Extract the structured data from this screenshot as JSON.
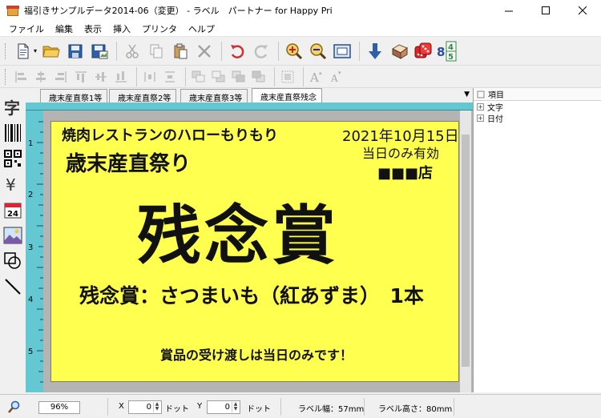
{
  "window": {
    "title": "福引きサンプルデータ2014-06（変更） - ラベル　パートナー for Happy Pri"
  },
  "menu": [
    "ファイル",
    "編集",
    "表示",
    "挿入",
    "プリンタ",
    "ヘルプ"
  ],
  "tabs": [
    "歳末産直祭1等",
    "歳末産直祭2等",
    "歳末産直祭3等",
    "歳末産直祭残念"
  ],
  "active_tab_index": 3,
  "ruler": [
    "1",
    "2",
    "3",
    "4",
    "5"
  ],
  "label": {
    "background": "#ffff50",
    "store_line": "焼肉レストランのハローもりもり",
    "date": "2021年10月15日",
    "validity": "当日のみ有効",
    "event_name": "歳末産直祭り",
    "shop": "■■■店",
    "prize_big": "残念賞",
    "prize_detail": "残念賞：さつまいも（紅あずま）　1本",
    "footer": "賞品の受け渡しは当日のみです！"
  },
  "tree": {
    "header": "項目",
    "items": [
      "文字",
      "日付"
    ]
  },
  "status": {
    "zoom": "96%",
    "x_label": "X",
    "x_value": "0",
    "x_unit": "ドット",
    "y_label": "Y",
    "y_value": "0",
    "y_unit": "ドット",
    "label_width": "ラベル幅：57mm",
    "label_height": "ラベル高さ：80mm"
  },
  "icons": {
    "toolbar1": [
      "new-document-icon",
      "open-folder-icon",
      "save-icon",
      "save-as-icon",
      "cut-icon",
      "copy-icon",
      "paste-icon",
      "delete-icon",
      "undo-icon",
      "redo-icon",
      "zoom-in-icon",
      "zoom-out-icon",
      "fit-page-icon",
      "import-icon",
      "print-icon",
      "lottery-dice-icon",
      "serial-number-icon"
    ],
    "toolbar2": [
      "align-left-icon",
      "align-center-icon",
      "align-right-icon",
      "align-top-icon",
      "align-middle-icon",
      "align-bottom-icon",
      "distribute-h-icon",
      "distribute-v-icon",
      "bring-front-icon",
      "send-back-icon",
      "forward-icon",
      "backward-icon",
      "group-icon",
      "font-larger-icon",
      "font-smaller-icon"
    ],
    "palette": [
      "text-tool-icon",
      "barcode-tool-icon",
      "qrcode-tool-icon",
      "price-tool-icon",
      "calendar-tool-icon",
      "image-tool-icon",
      "shape-tool-icon",
      "line-tool-icon"
    ]
  }
}
